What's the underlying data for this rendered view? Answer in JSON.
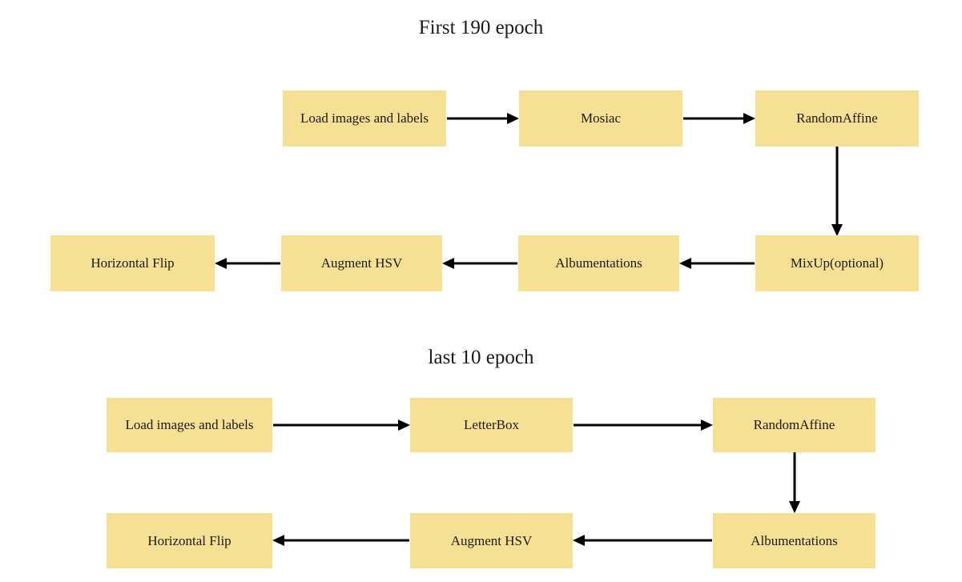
{
  "diagram": {
    "title_top": "First 190 epoch",
    "title_bottom": "last 10 epoch",
    "box_color": "#f5e093",
    "arrow_color": "#000000",
    "background_color": "#ffffff",
    "sections": [
      {
        "name": "first-190-epoch",
        "title": "First 190 epoch",
        "nodes": [
          {
            "id": "load-images-and-labels",
            "label": "Load images and labels"
          },
          {
            "id": "mosiac",
            "label": "Mosiac"
          },
          {
            "id": "random-affine",
            "label": "RandomAffine"
          },
          {
            "id": "mixup-optional",
            "label": "MixUp(optional)"
          },
          {
            "id": "albumentations",
            "label": "Albumentations"
          },
          {
            "id": "augment-hsv",
            "label": "Augment HSV"
          },
          {
            "id": "horizontal-flip",
            "label": "Horizontal Flip"
          }
        ],
        "edges": [
          {
            "from": "load-images-and-labels",
            "to": "mosiac",
            "direction": "right"
          },
          {
            "from": "mosiac",
            "to": "random-affine",
            "direction": "right"
          },
          {
            "from": "random-affine",
            "to": "mixup-optional",
            "direction": "down"
          },
          {
            "from": "mixup-optional",
            "to": "albumentations",
            "direction": "left"
          },
          {
            "from": "albumentations",
            "to": "augment-hsv",
            "direction": "left"
          },
          {
            "from": "augment-hsv",
            "to": "horizontal-flip",
            "direction": "left"
          }
        ]
      },
      {
        "name": "last-10-epoch",
        "title": "last 10 epoch",
        "nodes": [
          {
            "id": "load-images-and-labels",
            "label": "Load images and labels"
          },
          {
            "id": "letterbox",
            "label": "LetterBox"
          },
          {
            "id": "random-affine",
            "label": "RandomAffine"
          },
          {
            "id": "albumentations",
            "label": "Albumentations"
          },
          {
            "id": "augment-hsv",
            "label": "Augment HSV"
          },
          {
            "id": "horizontal-flip",
            "label": "Horizontal Flip"
          }
        ],
        "edges": [
          {
            "from": "load-images-and-labels",
            "to": "letterbox",
            "direction": "right"
          },
          {
            "from": "letterbox",
            "to": "random-affine",
            "direction": "right"
          },
          {
            "from": "random-affine",
            "to": "albumentations",
            "direction": "down"
          },
          {
            "from": "albumentations",
            "to": "augment-hsv",
            "direction": "left"
          },
          {
            "from": "augment-hsv",
            "to": "horizontal-flip",
            "direction": "left"
          }
        ]
      }
    ],
    "labels": {
      "top_r1_c1": "Load images and labels",
      "top_r1_c2": "Mosiac",
      "top_r1_c3": "RandomAffine",
      "top_r2_c1": "Horizontal Flip",
      "top_r2_c2": "Augment HSV",
      "top_r2_c3": "Albumentations",
      "top_r2_c4": "MixUp(optional)",
      "bot_r1_c1": "Load images and labels",
      "bot_r1_c2": "LetterBox",
      "bot_r1_c3": "RandomAffine",
      "bot_r2_c1": "Horizontal Flip",
      "bot_r2_c2": "Augment HSV",
      "bot_r2_c3": "Albumentations"
    }
  }
}
